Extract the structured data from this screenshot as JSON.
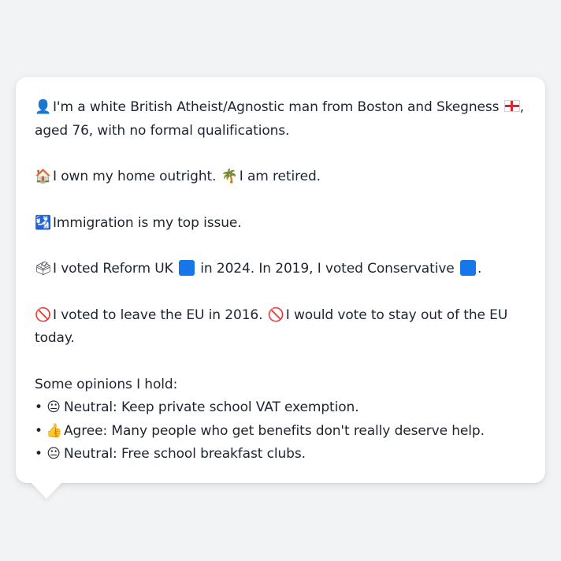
{
  "profile": {
    "identity": {
      "icon": "person-silhouette-icon",
      "icon_glyph": "👤",
      "text": "I'm a white British Atheist/Agnostic man from Boston and Skegness",
      "flag_icon": "england-flag-icon",
      "after_flag": ",",
      "line2": "aged 76, with no formal qualifications."
    },
    "housing": {
      "icon": "house-icon",
      "icon_glyph": "🏠",
      "text": "I own my home outright.",
      "icon2": "palm-tree-icon",
      "icon2_glyph": "🌴",
      "text2": "I am retired."
    },
    "issue": {
      "icon": "passport-control-icon",
      "icon_glyph": "🛂",
      "text": "Immigration is my top issue."
    },
    "votes": {
      "icon": "ballot-box-icon",
      "icon_glyph": "🗳",
      "text_a": "I voted Reform UK",
      "party1_color": "#1877e8",
      "text_b": "in 2024. In 2019, I voted Conservative",
      "party2_color": "#1877e8",
      "text_c": "."
    },
    "eu": {
      "icon": "prohibited-icon",
      "icon_glyph": "🚫",
      "text": "I voted to leave the EU in 2016.",
      "icon2": "prohibited-icon",
      "icon2_glyph": "🚫",
      "text2": "I would vote to stay out of the EU",
      "line2": "today."
    },
    "opinions": {
      "heading": "Some opinions I hold:",
      "items": [
        {
          "bullet": "•",
          "icon": "neutral-face-icon",
          "glyph": "😐",
          "text": "Neutral: Keep private school VAT exemption."
        },
        {
          "bullet": "•",
          "icon": "thumbs-up-icon",
          "glyph": "👍",
          "text": "Agree: Many people who get benefits don't really deserve help."
        },
        {
          "bullet": "•",
          "icon": "neutral-face-icon",
          "glyph": "😐",
          "text": "Neutral: Free school breakfast clubs."
        }
      ]
    }
  }
}
